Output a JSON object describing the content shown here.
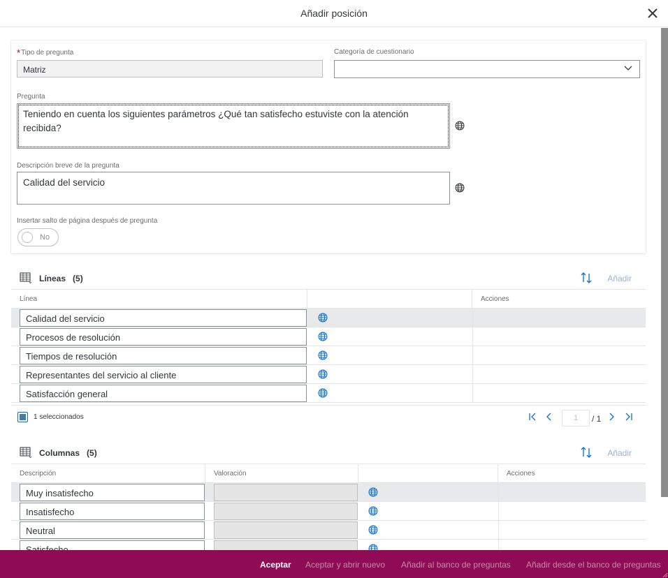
{
  "dialog": {
    "title": "Añadir posición"
  },
  "form": {
    "question_type_label": "Tipo de pregunta",
    "question_type_value": "Matriz",
    "category_label": "Categoría de cuestionario",
    "category_value": "",
    "question_label": "Pregunta",
    "question_value": "Teniendo en cuenta los siguientes parámetros ¿Qué tan satisfecho estuviste con la atención recibida?",
    "short_desc_label": "Descripción breve de la pregunta",
    "short_desc_value": "Calidad del servicio",
    "page_break_label": "Insertar salto de página después de pregunta",
    "page_break_value": "No"
  },
  "lines": {
    "title": "Líneas",
    "count": "(5)",
    "add_label": "Añadir",
    "col_line": "Línea",
    "col_actions": "Acciones",
    "rows": [
      "Calidad del servicio",
      "Procesos de resolución",
      "Tiempos de resolución",
      "Representantes del servicio al cliente",
      "Satisfacción general"
    ],
    "selected_text": "1 seleccionados",
    "page_current": "1",
    "page_total": "/ 1"
  },
  "columns": {
    "title": "Columnas",
    "count": "(5)",
    "add_label": "Añadir",
    "col_desc": "Descripción",
    "col_rating": "Valoración",
    "col_actions": "Acciones",
    "rows": [
      "Muy insatisfecho",
      "Insatisfecho",
      "Neutral",
      "Satisfecho"
    ]
  },
  "buttons": {
    "accept": "Aceptar",
    "accept_new": "Aceptar y abrir nuevo",
    "add_bank": "Añadir al banco de preguntas",
    "add_from_bank": "Añadir desde el banco de preguntas"
  },
  "colors": {
    "brand_bar": "#8f0b55",
    "accent": "#0a6ed1"
  },
  "icons": [
    "close-icon",
    "chevron-down-icon",
    "globe-icon",
    "table-icon",
    "sort-icon",
    "first-page-icon",
    "prev-page-icon",
    "next-page-icon",
    "last-page-icon"
  ]
}
